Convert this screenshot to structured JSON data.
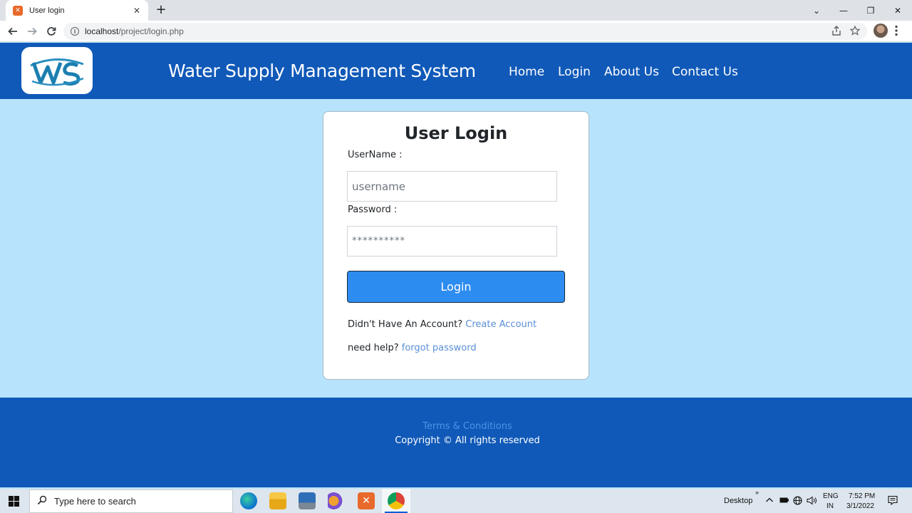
{
  "browser": {
    "tab_title": "User login",
    "tab_close": "✕",
    "new_tab": "+",
    "url_host": "localhost",
    "url_path": "/project/login.php",
    "window_controls": {
      "chevron": "⌄",
      "minimize": "—",
      "restore": "❐",
      "close": "✕"
    }
  },
  "header": {
    "logo_text": "WS",
    "title": "Water Supply Management System",
    "nav": [
      "Home",
      "Login",
      "About Us",
      "Contact Us"
    ]
  },
  "login": {
    "title": "User Login",
    "username_label": "UserName :",
    "username_placeholder": "username",
    "password_label": "Password :",
    "password_placeholder": "**********",
    "button": "Login",
    "no_account_text": "Didn't Have An Account?",
    "create_account_link": "Create Account",
    "help_text": "need help?",
    "forgot_link": "forgot password"
  },
  "footer": {
    "terms": "Terms & Conditions",
    "copyright": "Copyright © All rights reserved"
  },
  "taskbar": {
    "search_placeholder": "Type here to search",
    "desktop_label": "Desktop",
    "lang": "ENG",
    "region": "IN",
    "time": "7:52 PM",
    "date": "3/1/2022"
  },
  "colors": {
    "header_bg": "#1059b8",
    "page_bg": "#b7e3fc",
    "button_bg": "#2d8cf0",
    "link": "#5b8fd6"
  }
}
